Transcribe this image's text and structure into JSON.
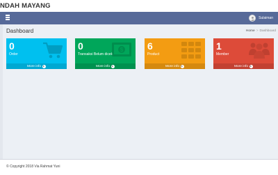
{
  "app": {
    "brand": "NDAH MAYANG"
  },
  "navbar": {
    "user_name": "Sulaiman"
  },
  "header": {
    "title": "Dashboard",
    "breadcrumb": {
      "home": "Home",
      "separator": ">",
      "current": "Dashboard"
    }
  },
  "boxes": [
    {
      "value": "0",
      "label": "Order",
      "more": "More info",
      "color": "#00c0ef",
      "icon": "cart-icon"
    },
    {
      "value": "0",
      "label": "Transaksi Belum dicek",
      "more": "More info",
      "color": "#00a65a",
      "icon": "money-icon"
    },
    {
      "value": "6",
      "label": "Product",
      "more": "More info",
      "color": "#f39c12",
      "icon": "grid-icon"
    },
    {
      "value": "1",
      "label": "Member",
      "more": "More info",
      "color": "#dd4b39",
      "icon": "users-icon"
    }
  ],
  "footer": {
    "copyright": "© Copyright 2018 Via Rahmat Yuni"
  }
}
